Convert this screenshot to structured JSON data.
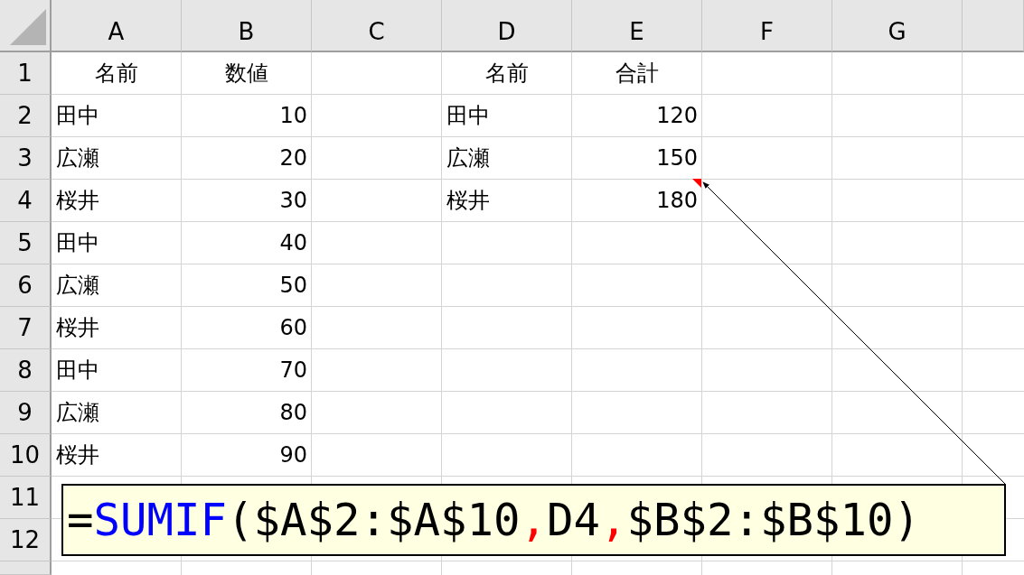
{
  "columns": [
    "A",
    "B",
    "C",
    "D",
    "E",
    "F",
    "G"
  ],
  "row_numbers": [
    "1",
    "2",
    "3",
    "4",
    "5",
    "6",
    "7",
    "8",
    "9",
    "10",
    "11",
    "12"
  ],
  "left_table": {
    "header": [
      "名前",
      "数値"
    ],
    "rows": [
      [
        "田中",
        "10"
      ],
      [
        "広瀬",
        "20"
      ],
      [
        "桜井",
        "30"
      ],
      [
        "田中",
        "40"
      ],
      [
        "広瀬",
        "50"
      ],
      [
        "桜井",
        "60"
      ],
      [
        "田中",
        "70"
      ],
      [
        "広瀬",
        "80"
      ],
      [
        "桜井",
        "90"
      ]
    ]
  },
  "right_table": {
    "header": [
      "名前",
      "合計"
    ],
    "rows": [
      {
        "name": "田中",
        "total": "120",
        "has_comment": false
      },
      {
        "name": "広瀬",
        "total": "150",
        "has_comment": false
      },
      {
        "name": "桜井",
        "total": "180",
        "has_comment": true
      }
    ]
  },
  "comment": {
    "segments": [
      {
        "text": "=",
        "color": "#000000"
      },
      {
        "text": "SUMIF",
        "color": "#0000ff"
      },
      {
        "text": "($A$2:$A$10",
        "color": "#000000"
      },
      {
        "text": ",",
        "color": "#ff0000"
      },
      {
        "text": "D4",
        "color": "#000000"
      },
      {
        "text": ",",
        "color": "#ff0000"
      },
      {
        "text": "$B$2:$B$10)",
        "color": "#000000"
      }
    ]
  }
}
